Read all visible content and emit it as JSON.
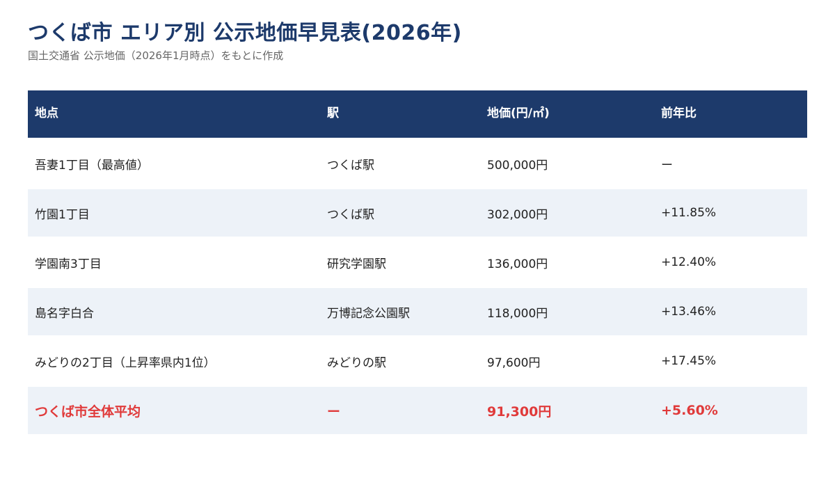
{
  "header": {
    "title": "つくば市 エリア別 公示地価早見表(2026年)",
    "subtitle": "国土交通省 公示地価（2026年1月時点）をもとに作成"
  },
  "table": {
    "columns": [
      "地点",
      "駅",
      "地価(円/㎡)",
      "前年比"
    ],
    "rows": [
      {
        "location": "吾妻1丁目（最高値）",
        "station": "つくば駅",
        "price": "500,000円",
        "change": "ー"
      },
      {
        "location": "竹園1丁目",
        "station": "つくば駅",
        "price": "302,000円",
        "change": "+11.85%"
      },
      {
        "location": "学園南3丁目",
        "station": "研究学園駅",
        "price": "136,000円",
        "change": "+12.40%"
      },
      {
        "location": "島名字白合",
        "station": "万博記念公園駅",
        "price": "118,000円",
        "change": "+13.46%"
      },
      {
        "location": "みどりの2丁目（上昇率県内1位）",
        "station": "みどりの駅",
        "price": "97,600円",
        "change": "+17.45%"
      }
    ],
    "total": {
      "location": "つくば市全体平均",
      "station": "ー",
      "price": "91,300円",
      "change": "+5.60%"
    }
  },
  "colors": {
    "header_bg": "#1d3a6b",
    "title": "#1d3a6b",
    "alt_row_bg": "#edf2f8",
    "total_text": "#e03a3a"
  }
}
